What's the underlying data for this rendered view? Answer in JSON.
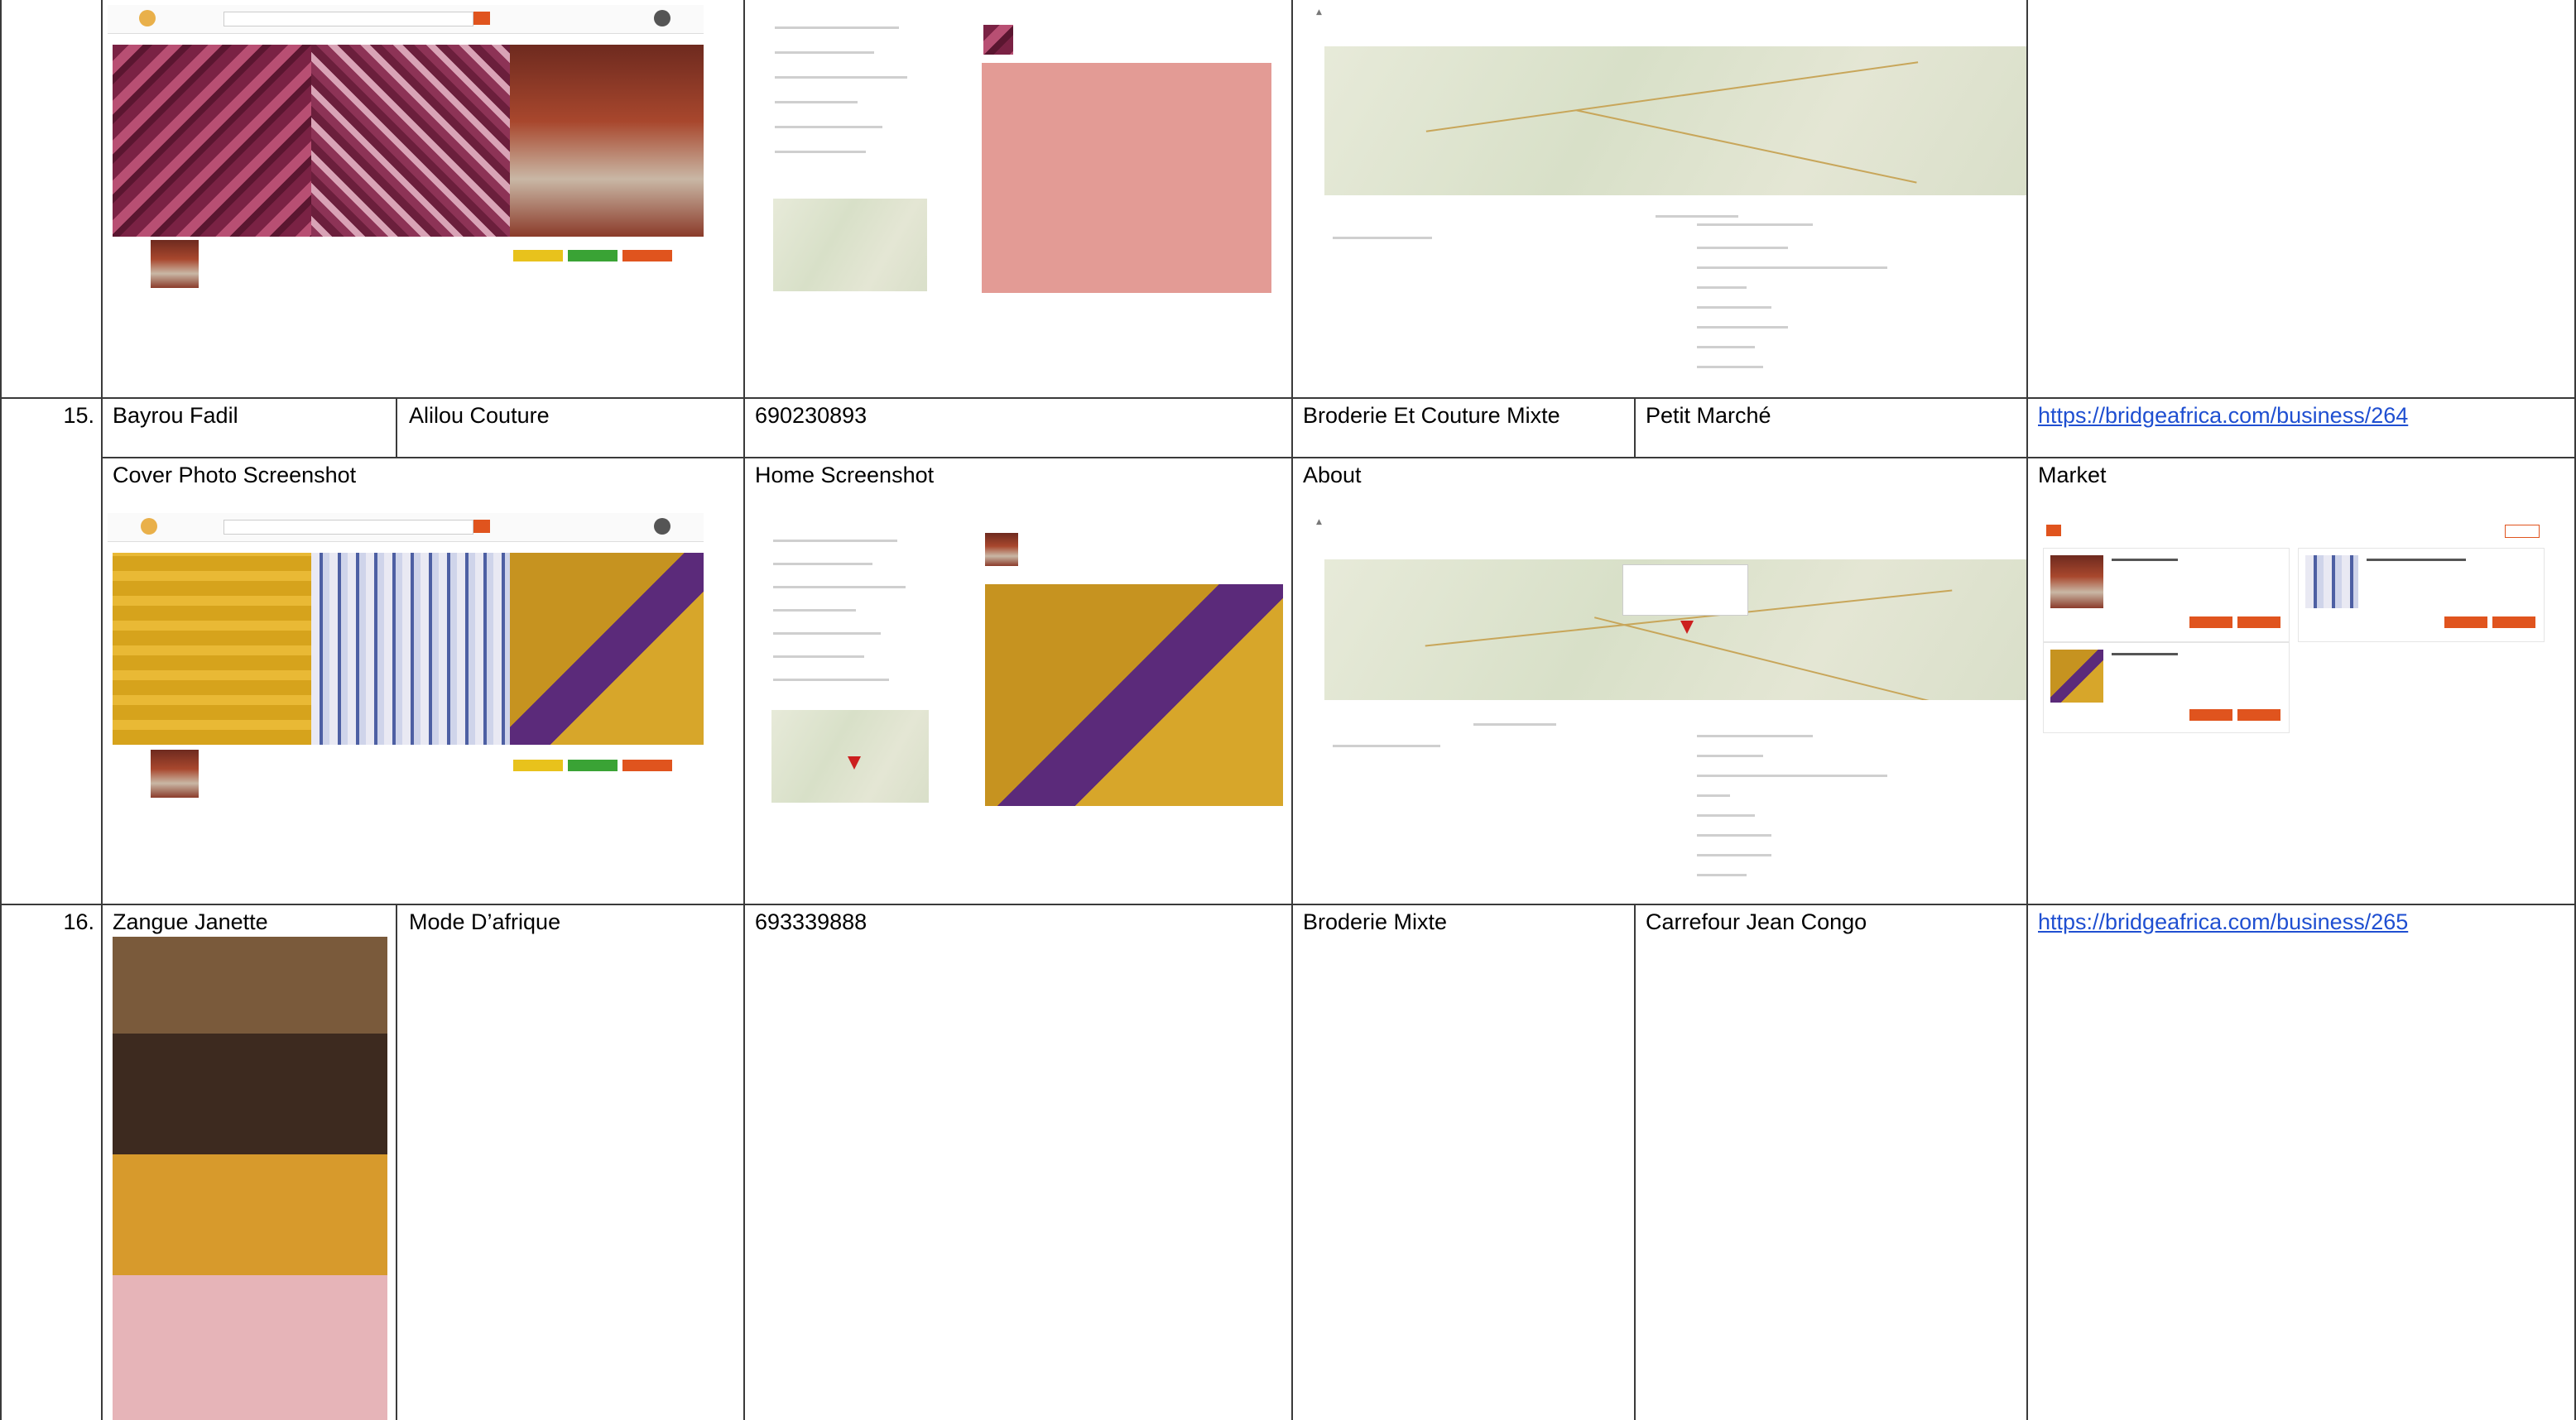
{
  "rows": [
    {
      "number": "15.",
      "owner": "Bayrou Fadil",
      "business_name": "Alilou Couture",
      "phone": "690230893",
      "category": "Broderie Et Couture Mixte",
      "location": "Petit Marché",
      "url": "https://bridgeafrica.com/business/264"
    },
    {
      "number": "16.",
      "owner": "Zangue Janette",
      "business_name": "Mode D’afrique",
      "phone": "693339888",
      "category": "Broderie Mixte",
      "location": "Carrefour Jean Congo",
      "url": "https://bridgeafrica.com/business/265"
    }
  ],
  "section_labels": {
    "cover": "Cover Photo Screenshot",
    "home": "Home Screenshot",
    "about": "About",
    "market": "Market"
  },
  "colors": {
    "link": "#1f4fd1",
    "border": "#3a3a3a",
    "brand_orange": "#e0541e"
  }
}
